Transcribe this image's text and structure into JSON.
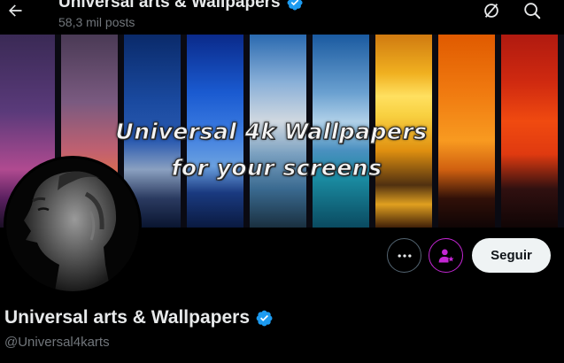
{
  "header": {
    "title": "Universal arts & Wallpapers",
    "post_count": "58,3 mil posts"
  },
  "banner": {
    "line1": "Universal 4k Wallpapers",
    "line2": "for your screens"
  },
  "profile": {
    "name": "Universal arts & Wallpapers",
    "handle": "@Universal4karts",
    "verified": true
  },
  "actions": {
    "follow_label": "Seguir"
  },
  "icons": {
    "back": "back-arrow-icon",
    "no_grok": "circle-slash-icon",
    "search": "search-icon",
    "more": "more-dots-icon",
    "subscribe": "subscribe-person-star-icon",
    "verified": "verified-badge-icon"
  },
  "colors": {
    "verified": "#1d9bf0",
    "subscribe_accent": "#c326d3",
    "follow_bg": "#eff3f4"
  }
}
